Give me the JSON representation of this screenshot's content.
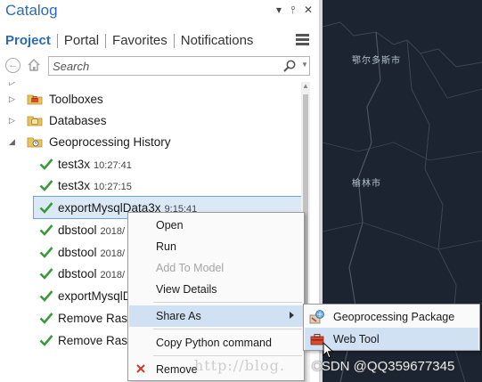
{
  "catalog": {
    "title": "Catalog",
    "header_buttons": {
      "dropdown": "▾",
      "pin": "⫯",
      "close": "✕"
    },
    "tabs": [
      {
        "label": "Project",
        "active": true
      },
      {
        "label": "Portal",
        "active": false
      },
      {
        "label": "Favorites",
        "active": false
      },
      {
        "label": "Notifications",
        "active": false
      }
    ],
    "search": {
      "placeholder": "Search"
    }
  },
  "tree": {
    "items": [
      {
        "type": "folder",
        "label": "Toolboxes",
        "expanded": false,
        "icon": "toolbox-icon"
      },
      {
        "type": "folder",
        "label": "Databases",
        "expanded": false,
        "icon": "database-folder-icon"
      },
      {
        "type": "folder",
        "label": "Geoprocessing History",
        "expanded": true,
        "icon": "history-folder-icon"
      }
    ],
    "history": [
      {
        "name": "test3x",
        "time": "10:27:41"
      },
      {
        "name": "test3x",
        "time": "10:27:15"
      },
      {
        "name": "exportMysqlData3x",
        "time": "9:15:41",
        "selected": true
      },
      {
        "name": "dbstool",
        "time": "2018/"
      },
      {
        "name": "dbstool",
        "time": "2018/"
      },
      {
        "name": "dbstool",
        "time": "2018/"
      },
      {
        "name": "exportMysqlD",
        "time": ""
      },
      {
        "name": "Remove Rast",
        "time": ""
      },
      {
        "name": "Remove Rast",
        "time": ""
      }
    ]
  },
  "context_menu": {
    "items": [
      {
        "label": "Open",
        "enabled": true
      },
      {
        "label": "Run",
        "enabled": true
      },
      {
        "label": "Add To Model",
        "enabled": false
      },
      {
        "label": "View Details",
        "enabled": true
      },
      {
        "label": "Share As",
        "enabled": true,
        "submenu": true,
        "active": true
      },
      {
        "label": "Copy Python command",
        "enabled": true
      },
      {
        "label": "Remove",
        "enabled": true,
        "icon": "remove-x-icon"
      }
    ],
    "submenu": [
      {
        "label": "Geoprocessing Package",
        "icon": "geoprocessing-package-icon"
      },
      {
        "label": "Web Tool",
        "icon": "web-tool-icon",
        "active": true
      }
    ]
  },
  "map": {
    "labels": [
      "鄂尔多斯市",
      "榆林市"
    ]
  },
  "watermark": {
    "url": "http://blog.",
    "credit": "CSDN @QQ359677345"
  },
  "colors": {
    "accent": "#2c6bb4",
    "selection": "#dbe9f6",
    "menu_highlight": "#cfe1f2",
    "check": "#3a9a3a",
    "remove": "#d03a2a",
    "map_bg": "#1b2430"
  }
}
